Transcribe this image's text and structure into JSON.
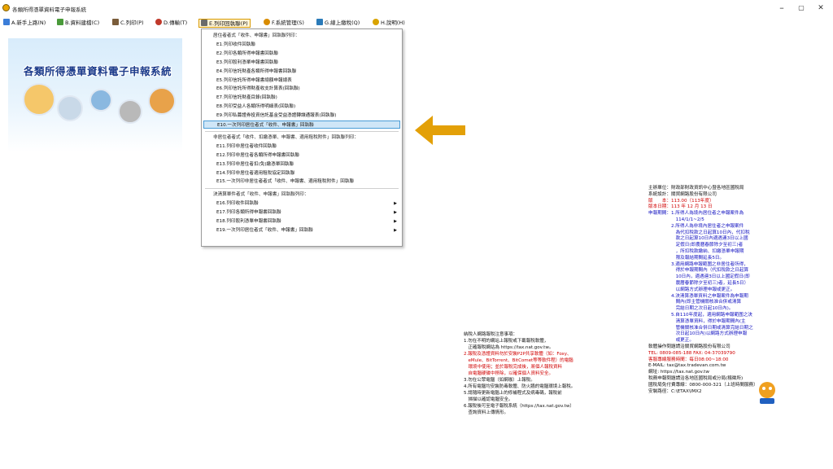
{
  "window": {
    "title": "各類所得憑單資料電子申報系統",
    "controls": {
      "minimize": "–",
      "maximize": "▢",
      "close": "✕"
    }
  },
  "menubar": [
    {
      "label": "A.新手上路(N)",
      "icon": "user-icon",
      "color": "#3b7dd8"
    },
    {
      "label": "B.資料建檔(C)",
      "icon": "edit-icon",
      "color": "#4a9a3a"
    },
    {
      "label": "C.列印(P)",
      "icon": "printer-icon",
      "color": "#7a5c3a"
    },
    {
      "label": "D.傳輸(T)",
      "icon": "transfer-icon",
      "color": "#c0392b"
    },
    {
      "label": "E.列印回執聯(P)",
      "icon": "receipt-icon",
      "color": "#555555"
    },
    {
      "label": "F.系統管理(S)",
      "icon": "gear-icon",
      "color": "#d98c00"
    },
    {
      "label": "G.線上繳稅(Q)",
      "icon": "pay-icon",
      "color": "#2b7bb9"
    },
    {
      "label": "H.說明(H)",
      "icon": "help-icon",
      "color": "#d9a300"
    }
  ],
  "dropdown": [
    {
      "type": "group",
      "label": "居住者者式「收件、申報書」回執聯列印："
    },
    {
      "type": "item",
      "label": "E1.列印收件回執聯"
    },
    {
      "type": "item",
      "label": "E2.列印各類所得申報書回執聯"
    },
    {
      "type": "item",
      "label": "E3.列印股利憑單申報書回執聯"
    },
    {
      "type": "item",
      "label": "E4.列印信託財產各類所得申報書回執聯"
    },
    {
      "type": "item",
      "label": "E5.列印信託所得申報書總額申報總表"
    },
    {
      "type": "item",
      "label": "E6.列印信託所得財產收支計算表(回執聯)"
    },
    {
      "type": "item",
      "label": "E7.列印信託財產目錄(回執聯)"
    },
    {
      "type": "item",
      "label": "E8.列印受益人各類所得明細表(回執聯)"
    },
    {
      "type": "item",
      "label": "E9.列印私募證券投資信託基金受益憑證轉讓通報表(回執聯)"
    },
    {
      "type": "item",
      "label": "E10.一次列印居住者式「收件、申報書」回執聯",
      "highlight": true
    },
    {
      "type": "sep"
    },
    {
      "type": "group",
      "label": "非居住者者式「收件、扣繳憑單、申報書、適用租稅附件」回執聯列印："
    },
    {
      "type": "item",
      "label": "E11.列印非居住者收件回執聯"
    },
    {
      "type": "item",
      "label": "E12.列印非居住者各類所得申報書回執聯"
    },
    {
      "type": "item",
      "label": "E13.列印非居住者扣(免)繳憑單回執聯"
    },
    {
      "type": "item",
      "label": "E14.列印非居住者適用租稅協定回執聯"
    },
    {
      "type": "item",
      "label": "E15.一次列印非居住者者式「收件、申報書、適用租稅附件」回執聯"
    },
    {
      "type": "sep"
    },
    {
      "type": "group",
      "label": "決清算單件者式「收件、申報書」回執聯列印："
    },
    {
      "type": "item",
      "label": "E16.列印收件回執聯",
      "submenu": true
    },
    {
      "type": "item",
      "label": "E17.列印各類所得申報書回執聯",
      "submenu": true
    },
    {
      "type": "item",
      "label": "E18.列印股利憑單申報書回執聯",
      "submenu": true
    },
    {
      "type": "item",
      "label": "E19.一次列印居住者式「收件、申報書」回執聯",
      "submenu": true
    }
  ],
  "banner": {
    "title": "各類所得憑單資料電子申報系統"
  },
  "notice": {
    "heading": "納稅人網路報稅注意事項：",
    "lines": [
      {
        "text": "1.勿在不明的網站上報稅或下載報稅軟體，",
        "red": false
      },
      {
        "text": "　正確報稅網站為 https://tax.nat.gov.tw。",
        "red": false
      },
      {
        "text": "2.報稅及憑證資料勿於安裝P2P共享軟體（如：Foxy、",
        "red": true
      },
      {
        "text": "　eMule、BitTorrent、BitComet等等軟件程）的電腦",
        "red": true
      },
      {
        "text": "　環境中使用；並於報稅完成後，將個人報稅資料",
        "red": true
      },
      {
        "text": "　自電腦硬碟中移除，以確保個人資料安全。",
        "red": true
      },
      {
        "text": "3.勿在公眾電腦（如網咖）上報稅。",
        "red": false
      },
      {
        "text": "4.所有電腦均安裝防毒軟體、防火牆的電腦環境上報稅。",
        "red": false
      },
      {
        "text": "5.請隨時更新電腦上的修補程式及病毒碼，報稅前",
        "red": false
      },
      {
        "text": "　掃描以確認電腦安全。",
        "red": false
      },
      {
        "text": "6.報稅後可至電子報稅系統（https://tax.nat.gov.tw）",
        "red": false
      },
      {
        "text": "　查詢資料上傳情形。",
        "red": false
      }
    ]
  },
  "info": {
    "lines": [
      {
        "text": "主辦單位：財政部財政資訊中心暨各地區國稅局",
        "cls": ""
      },
      {
        "text": "系統設計：關貿網路股份有限公司",
        "cls": ""
      },
      {
        "text": "版　　本：113.00（113年度）",
        "cls": "red"
      },
      {
        "text": "版本日期：113 年 12 月 13 日",
        "cls": "red"
      },
      {
        "text": "申報期間：1.所得人為境內居住者之申報案件為",
        "cls": "blue"
      },
      {
        "text": "　　　　　　114/1/1~2/5",
        "cls": "blue"
      },
      {
        "text": "　　　　　2.所得人為非境內居住者之申報案件",
        "cls": "blue"
      },
      {
        "text": "　　　　　　為代扣稅款之日起算10日內，代扣稅",
        "cls": "blue"
      },
      {
        "text": "　　　　　　款之日起算10日內適遇連3日以上國",
        "cls": "blue"
      },
      {
        "text": "　　　　　　定假日(即農曆春節除夕至初三)者",
        "cls": "blue"
      },
      {
        "text": "　　　　　　，所扣稅款繳納、扣繳憑單申報期",
        "cls": "blue"
      },
      {
        "text": "　　　　　　限及報結期間延長5日。",
        "cls": "blue"
      },
      {
        "text": "　　　　　3.適用網路申報範圍之非居住者所得，",
        "cls": "blue"
      },
      {
        "text": "　　　　　　得於申報期間內（代扣稅款之日起算",
        "cls": "blue"
      },
      {
        "text": "　　　　　　10日內，適遇連3日以上國定假日(即",
        "cls": "blue"
      },
      {
        "text": "　　　　　　農曆春節除夕至初三)者，延長5日）",
        "cls": "blue"
      },
      {
        "text": "　　　　　　以網路方式辦理申報或更正。",
        "cls": "blue"
      },
      {
        "text": "　　　　　4.決清算憑單資料之申報案件為申報期",
        "cls": "blue"
      },
      {
        "text": "　　　　　　間內(即主管機關核准合併或清算",
        "cls": "blue"
      },
      {
        "text": "　　　　　　完結日期之次日起10日內)。",
        "cls": "blue"
      },
      {
        "text": "　　　　　5.自110年度起，適用網路申報範圍之決",
        "cls": "blue"
      },
      {
        "text": "　　　　　　清算憑單資料，得於申報期間內(主",
        "cls": "blue"
      },
      {
        "text": "　　　　　　管機關核准合併日期或清算完結日期之",
        "cls": "blue"
      },
      {
        "text": "　　　　　　次日起10日內)以網路方式辦理申報",
        "cls": "blue"
      },
      {
        "text": "　　　　　　或更正。",
        "cls": "blue"
      },
      {
        "text": "軟體操作問題請洽關貿網路股份有限公司",
        "cls": ""
      },
      {
        "text": "TEL: 0809-085-188 FAX: 04-37039790",
        "cls": "red"
      },
      {
        "text": "客服專線服務時間：每日08:00~18:00",
        "cls": "red"
      },
      {
        "text": "E-MAIL: tax@tax.tradevan.com.tw",
        "cls": ""
      },
      {
        "text": "網址: https://tax.nat.gov.tw",
        "cls": ""
      },
      {
        "text": "稅務申報問題請洽各地區國稅局或分局(稽徵所)",
        "cls": ""
      },
      {
        "text": "國稅局免付費專線：0800-000-321（上班時間服務）",
        "cls": ""
      },
      {
        "text": "安裝路徑：C:\\ETAX\\IMX2",
        "cls": ""
      }
    ]
  },
  "colors": {
    "accent": "#d99a00",
    "highlight": "#cfe6f7",
    "arrow": "#e3a008"
  }
}
